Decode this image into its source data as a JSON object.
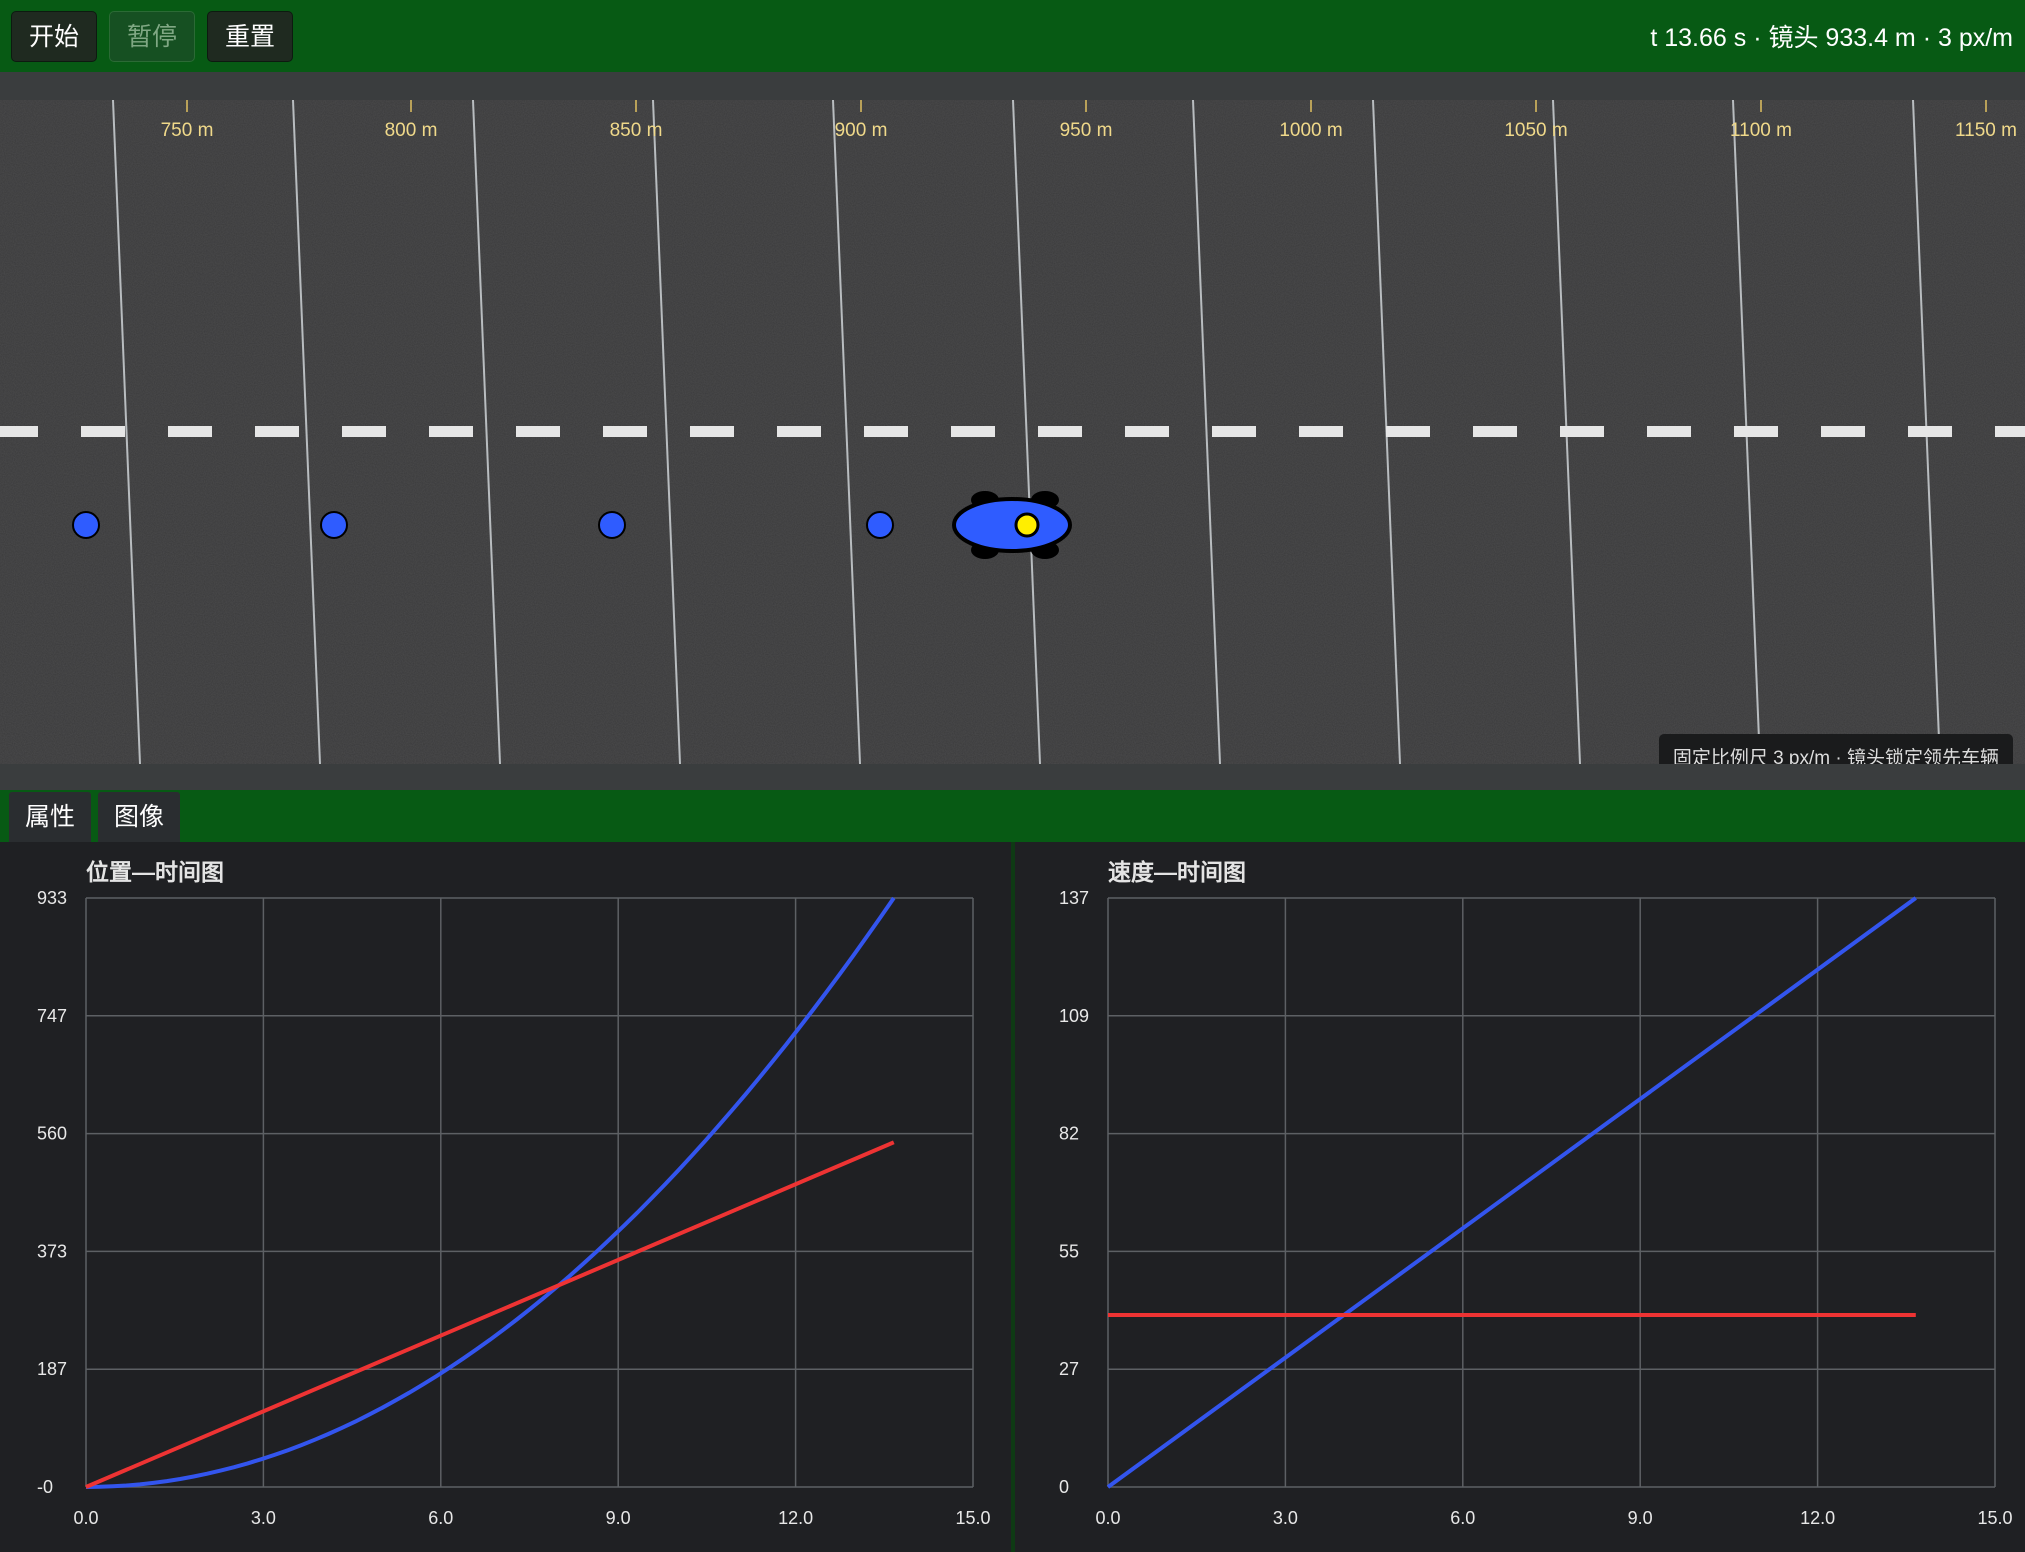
{
  "toolbar": {
    "start_label": "开始",
    "pause_label": "暂停",
    "reset_label": "重置",
    "status": "t 13.66 s · 镜头 933.4 m · 3 px/m"
  },
  "road": {
    "ruler_labels": [
      "750 m",
      "800 m",
      "850 m",
      "900 m",
      "950 m",
      "1000 m",
      "1050 m",
      "1100 m",
      "1150 m"
    ],
    "hint": "固定比例尺 3 px/m · 镜头锁定领先车辆",
    "colors": {
      "asphalt": "#3a3a3b",
      "ball": "#2f5cff",
      "car": "#2f5cff",
      "driver": "#ffee00",
      "lane_mark": "#e6e6e6"
    }
  },
  "tabs": {
    "properties": "属性",
    "graphs": "图像"
  },
  "charts": {
    "position": {
      "title": "位置—时间图"
    },
    "velocity": {
      "title": "速度—时间图"
    }
  },
  "chart_data": [
    {
      "type": "line",
      "title": "位置—时间图",
      "xlabel": "",
      "ylabel": "",
      "xlim": [
        0,
        15
      ],
      "ylim": [
        0,
        933
      ],
      "xticks": [
        "0.0",
        "3.0",
        "6.0",
        "9.0",
        "12.0",
        "15.0"
      ],
      "yticks": [
        "-0",
        "187",
        "373",
        "560",
        "747",
        "933"
      ],
      "grid": true,
      "series": [
        {
          "color": "#3355ee",
          "x": [
            0,
            2,
            4,
            6,
            8,
            10,
            12,
            13.66
          ],
          "y": [
            0,
            20,
            80,
            180,
            320,
            500,
            720,
            933
          ]
        },
        {
          "color": "#ee3333",
          "x": [
            0,
            13.66
          ],
          "y": [
            0,
            546
          ]
        }
      ]
    },
    {
      "type": "line",
      "title": "速度—时间图",
      "xlabel": "",
      "ylabel": "",
      "xlim": [
        0,
        15
      ],
      "ylim": [
        0,
        137
      ],
      "xticks": [
        "0.0",
        "3.0",
        "6.0",
        "9.0",
        "12.0",
        "15.0"
      ],
      "yticks": [
        "0",
        "27",
        "55",
        "82",
        "109",
        "137"
      ],
      "grid": true,
      "series": [
        {
          "color": "#3355ee",
          "x": [
            0,
            13.66
          ],
          "y": [
            0,
            137
          ]
        },
        {
          "color": "#ee3333",
          "x": [
            0,
            13.66
          ],
          "y": [
            40,
            40
          ]
        }
      ]
    }
  ]
}
